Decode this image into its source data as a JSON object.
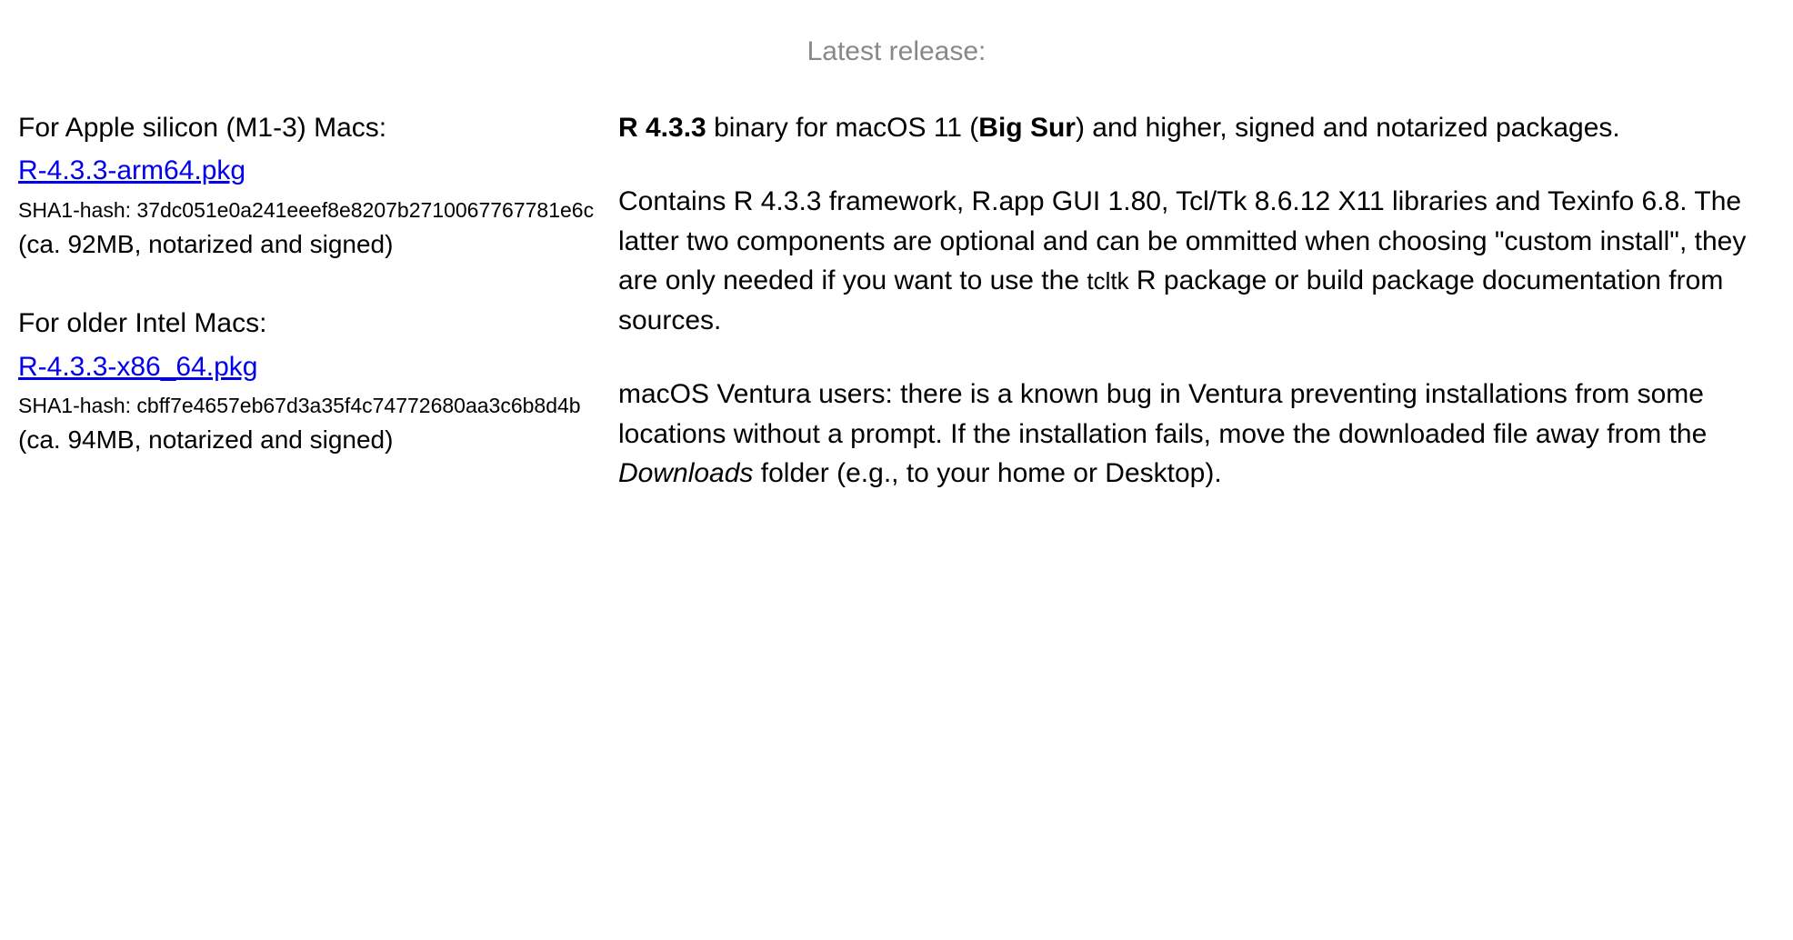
{
  "header": "Latest release:",
  "left": {
    "arm": {
      "label": "For Apple silicon (M1-3) Macs:",
      "link_text": "R-4.3.3-arm64.pkg",
      "hash_label": "SHA1-hash: ",
      "hash_value": "37dc051e0a241eeef8e8207b2710067767781e6c",
      "size_line": "(ca. 92MB, notarized and signed)"
    },
    "intel": {
      "label": "For older Intel Macs:",
      "link_text": "R-4.3.3-x86_64.pkg",
      "hash_label": "SHA1-hash: ",
      "hash_value": "cbff7e4657eb67d3a35f4c74772680aa3c6b8d4b",
      "size_line": "(ca. 94MB, notarized and signed)"
    }
  },
  "right": {
    "p1_bold1": "R 4.3.3",
    "p1_mid1": " binary for macOS 11 (",
    "p1_bold2": "Big Sur",
    "p1_mid2": ") and higher, signed and notarized packages.",
    "p2_a": "Contains R 4.3.3 framework, R.app GUI 1.80, Tcl/Tk 8.6.12 X11 libraries and Texinfo 6.8. The latter two components are optional and can be ommitted when choosing \"custom install\", they are only needed if you want to use the ",
    "p2_tt": "tcltk",
    "p2_b": " R package or build package documentation from sources.",
    "p3_a": "macOS Ventura users: there is a known bug in Ventura preventing installations from some locations without a prompt. If the installation fails, move the downloaded file away from the ",
    "p3_it": "Downloads",
    "p3_b": " folder (e.g., to your home or Desktop)."
  }
}
